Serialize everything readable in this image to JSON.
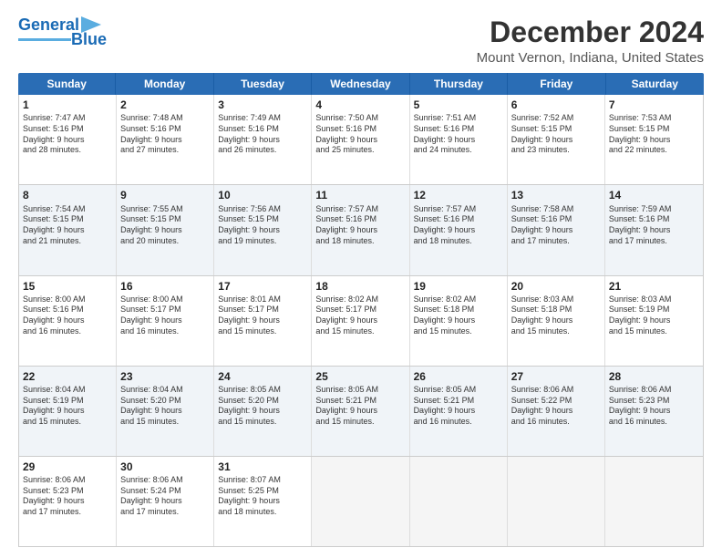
{
  "header": {
    "logo_line1": "General",
    "logo_line2": "Blue",
    "main_title": "December 2024",
    "sub_title": "Mount Vernon, Indiana, United States"
  },
  "days_of_week": [
    "Sunday",
    "Monday",
    "Tuesday",
    "Wednesday",
    "Thursday",
    "Friday",
    "Saturday"
  ],
  "rows": [
    [
      {
        "day": "1",
        "lines": [
          "Sunrise: 7:47 AM",
          "Sunset: 5:16 PM",
          "Daylight: 9 hours",
          "and 28 minutes."
        ]
      },
      {
        "day": "2",
        "lines": [
          "Sunrise: 7:48 AM",
          "Sunset: 5:16 PM",
          "Daylight: 9 hours",
          "and 27 minutes."
        ]
      },
      {
        "day": "3",
        "lines": [
          "Sunrise: 7:49 AM",
          "Sunset: 5:16 PM",
          "Daylight: 9 hours",
          "and 26 minutes."
        ]
      },
      {
        "day": "4",
        "lines": [
          "Sunrise: 7:50 AM",
          "Sunset: 5:16 PM",
          "Daylight: 9 hours",
          "and 25 minutes."
        ]
      },
      {
        "day": "5",
        "lines": [
          "Sunrise: 7:51 AM",
          "Sunset: 5:16 PM",
          "Daylight: 9 hours",
          "and 24 minutes."
        ]
      },
      {
        "day": "6",
        "lines": [
          "Sunrise: 7:52 AM",
          "Sunset: 5:15 PM",
          "Daylight: 9 hours",
          "and 23 minutes."
        ]
      },
      {
        "day": "7",
        "lines": [
          "Sunrise: 7:53 AM",
          "Sunset: 5:15 PM",
          "Daylight: 9 hours",
          "and 22 minutes."
        ]
      }
    ],
    [
      {
        "day": "8",
        "lines": [
          "Sunrise: 7:54 AM",
          "Sunset: 5:15 PM",
          "Daylight: 9 hours",
          "and 21 minutes."
        ]
      },
      {
        "day": "9",
        "lines": [
          "Sunrise: 7:55 AM",
          "Sunset: 5:15 PM",
          "Daylight: 9 hours",
          "and 20 minutes."
        ]
      },
      {
        "day": "10",
        "lines": [
          "Sunrise: 7:56 AM",
          "Sunset: 5:15 PM",
          "Daylight: 9 hours",
          "and 19 minutes."
        ]
      },
      {
        "day": "11",
        "lines": [
          "Sunrise: 7:57 AM",
          "Sunset: 5:16 PM",
          "Daylight: 9 hours",
          "and 18 minutes."
        ]
      },
      {
        "day": "12",
        "lines": [
          "Sunrise: 7:57 AM",
          "Sunset: 5:16 PM",
          "Daylight: 9 hours",
          "and 18 minutes."
        ]
      },
      {
        "day": "13",
        "lines": [
          "Sunrise: 7:58 AM",
          "Sunset: 5:16 PM",
          "Daylight: 9 hours",
          "and 17 minutes."
        ]
      },
      {
        "day": "14",
        "lines": [
          "Sunrise: 7:59 AM",
          "Sunset: 5:16 PM",
          "Daylight: 9 hours",
          "and 17 minutes."
        ]
      }
    ],
    [
      {
        "day": "15",
        "lines": [
          "Sunrise: 8:00 AM",
          "Sunset: 5:16 PM",
          "Daylight: 9 hours",
          "and 16 minutes."
        ]
      },
      {
        "day": "16",
        "lines": [
          "Sunrise: 8:00 AM",
          "Sunset: 5:17 PM",
          "Daylight: 9 hours",
          "and 16 minutes."
        ]
      },
      {
        "day": "17",
        "lines": [
          "Sunrise: 8:01 AM",
          "Sunset: 5:17 PM",
          "Daylight: 9 hours",
          "and 15 minutes."
        ]
      },
      {
        "day": "18",
        "lines": [
          "Sunrise: 8:02 AM",
          "Sunset: 5:17 PM",
          "Daylight: 9 hours",
          "and 15 minutes."
        ]
      },
      {
        "day": "19",
        "lines": [
          "Sunrise: 8:02 AM",
          "Sunset: 5:18 PM",
          "Daylight: 9 hours",
          "and 15 minutes."
        ]
      },
      {
        "day": "20",
        "lines": [
          "Sunrise: 8:03 AM",
          "Sunset: 5:18 PM",
          "Daylight: 9 hours",
          "and 15 minutes."
        ]
      },
      {
        "day": "21",
        "lines": [
          "Sunrise: 8:03 AM",
          "Sunset: 5:19 PM",
          "Daylight: 9 hours",
          "and 15 minutes."
        ]
      }
    ],
    [
      {
        "day": "22",
        "lines": [
          "Sunrise: 8:04 AM",
          "Sunset: 5:19 PM",
          "Daylight: 9 hours",
          "and 15 minutes."
        ]
      },
      {
        "day": "23",
        "lines": [
          "Sunrise: 8:04 AM",
          "Sunset: 5:20 PM",
          "Daylight: 9 hours",
          "and 15 minutes."
        ]
      },
      {
        "day": "24",
        "lines": [
          "Sunrise: 8:05 AM",
          "Sunset: 5:20 PM",
          "Daylight: 9 hours",
          "and 15 minutes."
        ]
      },
      {
        "day": "25",
        "lines": [
          "Sunrise: 8:05 AM",
          "Sunset: 5:21 PM",
          "Daylight: 9 hours",
          "and 15 minutes."
        ]
      },
      {
        "day": "26",
        "lines": [
          "Sunrise: 8:05 AM",
          "Sunset: 5:21 PM",
          "Daylight: 9 hours",
          "and 16 minutes."
        ]
      },
      {
        "day": "27",
        "lines": [
          "Sunrise: 8:06 AM",
          "Sunset: 5:22 PM",
          "Daylight: 9 hours",
          "and 16 minutes."
        ]
      },
      {
        "day": "28",
        "lines": [
          "Sunrise: 8:06 AM",
          "Sunset: 5:23 PM",
          "Daylight: 9 hours",
          "and 16 minutes."
        ]
      }
    ],
    [
      {
        "day": "29",
        "lines": [
          "Sunrise: 8:06 AM",
          "Sunset: 5:23 PM",
          "Daylight: 9 hours",
          "and 17 minutes."
        ]
      },
      {
        "day": "30",
        "lines": [
          "Sunrise: 8:06 AM",
          "Sunset: 5:24 PM",
          "Daylight: 9 hours",
          "and 17 minutes."
        ]
      },
      {
        "day": "31",
        "lines": [
          "Sunrise: 8:07 AM",
          "Sunset: 5:25 PM",
          "Daylight: 9 hours",
          "and 18 minutes."
        ]
      },
      {
        "day": "",
        "lines": []
      },
      {
        "day": "",
        "lines": []
      },
      {
        "day": "",
        "lines": []
      },
      {
        "day": "",
        "lines": []
      }
    ]
  ],
  "alt_rows": [
    1,
    3
  ]
}
